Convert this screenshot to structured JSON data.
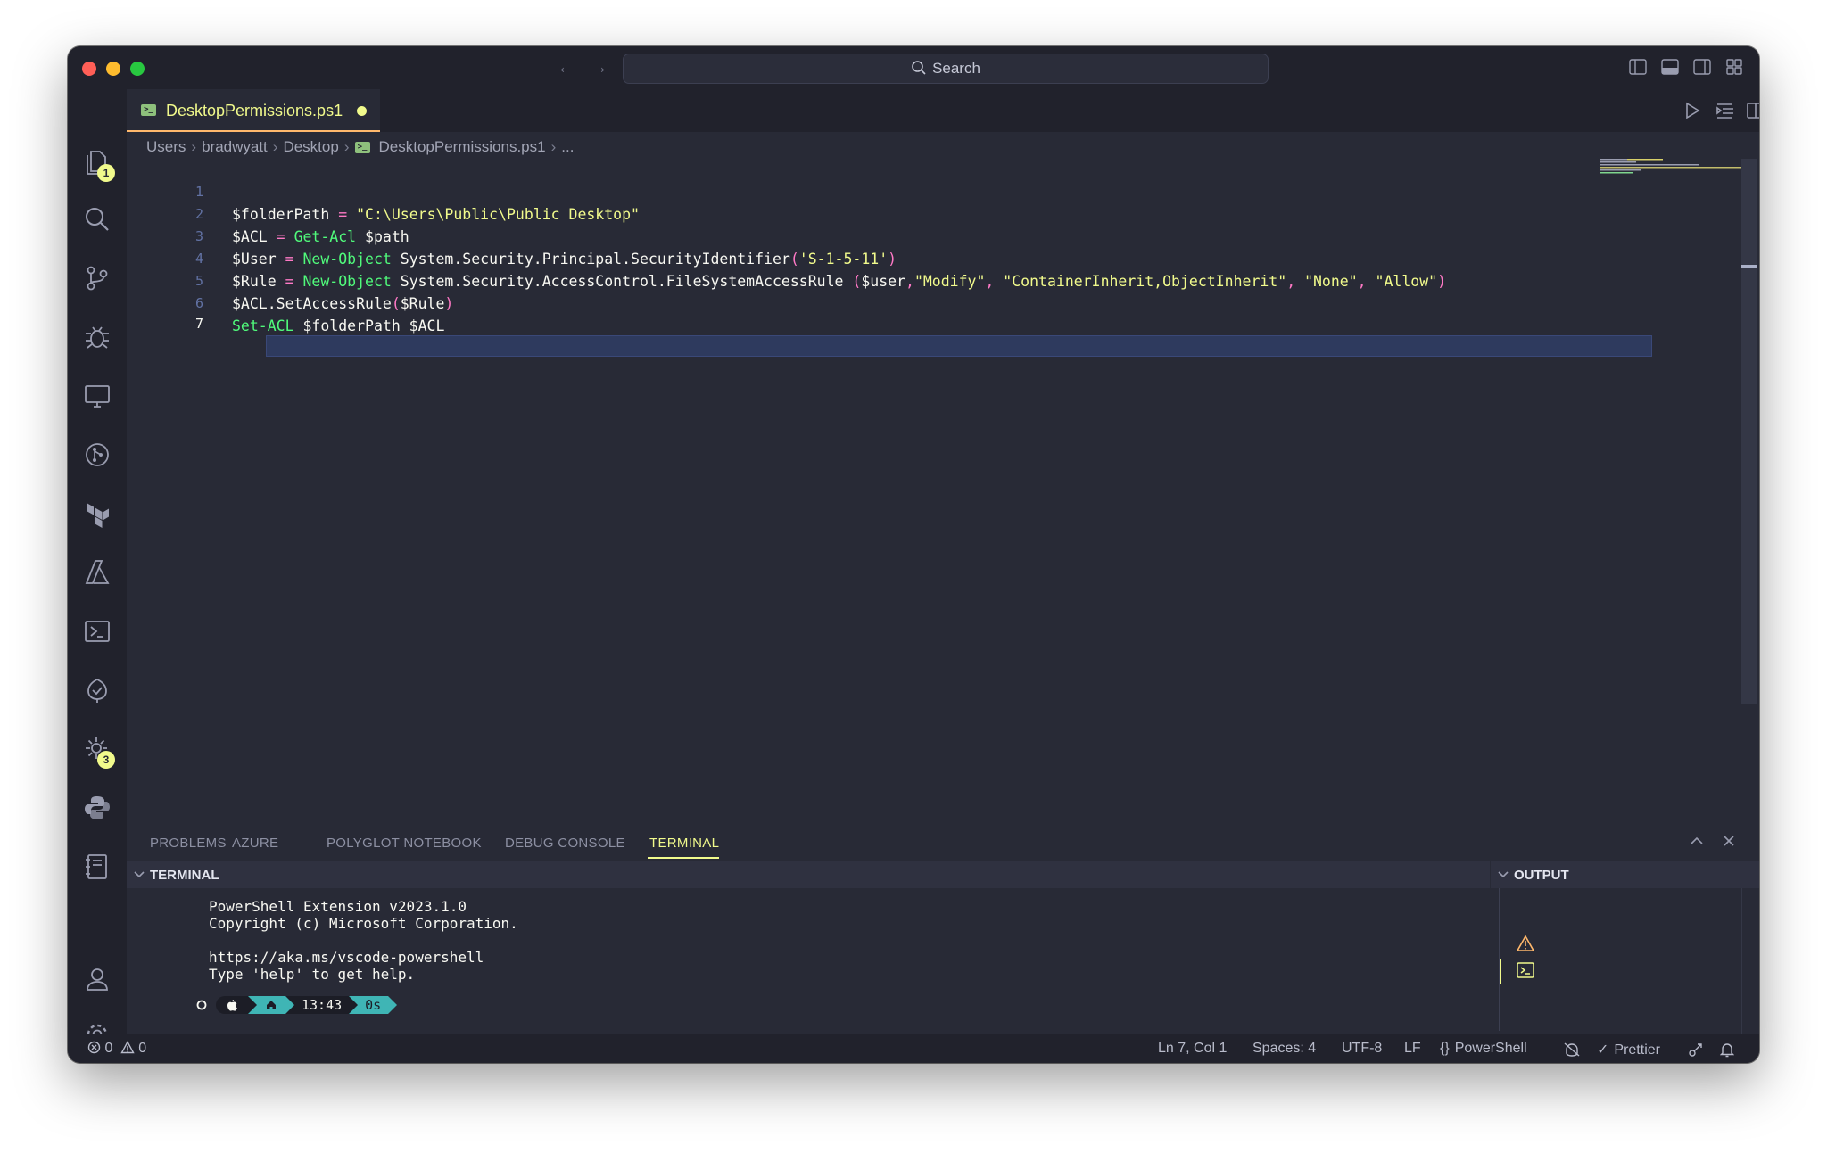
{
  "window": {
    "search_label": "Search",
    "traffic_colors": [
      "#ff5f57",
      "#febc2e",
      "#28c840"
    ]
  },
  "activity": {
    "explorer_badge": "1",
    "settings_badge": "3"
  },
  "tab": {
    "title": "DesktopPermissions.ps1",
    "language_icon": "powershell-file-icon",
    "modified": true
  },
  "breadcrumb": [
    "Users",
    "bradwyatt",
    "Desktop",
    "DesktopPermissions.ps1",
    "..."
  ],
  "code": {
    "lines": [
      {
        "n": "1"
      },
      {
        "n": "2"
      },
      {
        "n": "3"
      },
      {
        "n": "4"
      },
      {
        "n": "5"
      },
      {
        "n": "6"
      },
      {
        "n": "7"
      }
    ],
    "tokens": {
      "l1": [
        "$folderPath",
        " = ",
        "\"C:\\Users\\Public\\Public Desktop\""
      ],
      "l2": [
        "$ACL",
        " = ",
        "Get-Acl",
        " $path"
      ],
      "l3": [
        "$User",
        " = ",
        "New-Object",
        " System.Security.Principal.SecurityIdentifier",
        "(",
        "'S-1-5-11'",
        ")"
      ],
      "l4": [
        "$Rule",
        " = ",
        "New-Object",
        " System.Security.AccessControl.FileSystemAccessRule ",
        "(",
        "$user",
        ",",
        "\"Modify\"",
        ", ",
        "\"ContainerInherit,ObjectInherit\"",
        ", ",
        "\"None\"",
        ", ",
        "\"Allow\"",
        ")"
      ],
      "l5": [
        "$ACL.SetAccessRule",
        "(",
        "$Rule",
        ")"
      ],
      "l6": [
        "Set-ACL",
        " $folderPath $ACL"
      ]
    }
  },
  "panel": {
    "tabs": [
      "PROBLEMS",
      "AZURE",
      "POLYGLOT NOTEBOOK",
      "DEBUG CONSOLE",
      "TERMINAL"
    ],
    "active_tab": "TERMINAL",
    "terminal_header": "TERMINAL",
    "output_header": "OUTPUT",
    "terminal_lines": [
      "PowerShell Extension v2023.1.0",
      "Copyright (c) Microsoft Corporation.",
      "",
      "https://aka.ms/vscode-powershell",
      "Type 'help' to get help."
    ],
    "prompt": {
      "time": "13:43",
      "duration": "0s"
    }
  },
  "status": {
    "errors": "0",
    "warnings": "0",
    "position": "Ln 7, Col 1",
    "spaces": "Spaces: 4",
    "encoding": "UTF-8",
    "eol": "LF",
    "language": "PowerShell",
    "formatter": "Prettier"
  }
}
